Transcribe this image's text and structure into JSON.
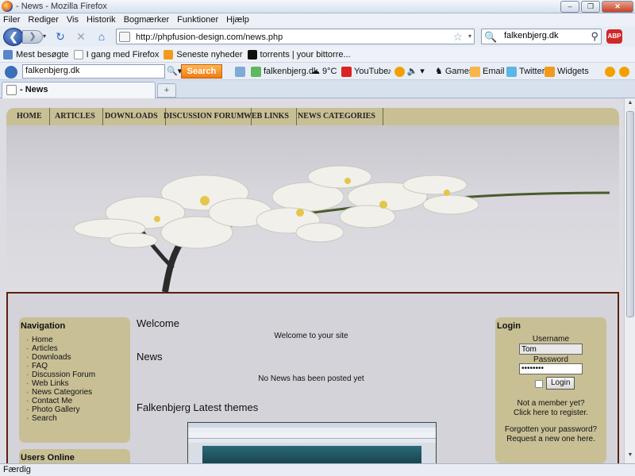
{
  "window": {
    "title": "- News - Mozilla Firefox"
  },
  "menu": [
    "Filer",
    "Rediger",
    "Vis",
    "Historik",
    "Bogmærker",
    "Funktioner",
    "Hjælp"
  ],
  "nav": {
    "url": "http://phpfusion-design.com/news.php",
    "search_value": "falkenbjerg.dk",
    "abp_label": "ABP"
  },
  "bookmarks": [
    {
      "label": "Mest besøgte",
      "icon": "most-visited-icon"
    },
    {
      "label": "I gang med Firefox",
      "icon": "page-icon"
    },
    {
      "label": "Seneste nyheder",
      "icon": "rss-icon"
    },
    {
      "label": "torrents | your bittorre...",
      "icon": "torrent-icon"
    }
  ],
  "toolbar2": {
    "search_value": "falkenbjerg.dk",
    "search_button": "Search",
    "domain": "falkenbjerg.dk",
    "weather": "9°C",
    "youtube": "YouTube",
    "games": "Games",
    "email": "Email",
    "twitter": "Twitter",
    "widgets": "Widgets"
  },
  "tab": {
    "title": "- News",
    "new_tab": "+"
  },
  "site": {
    "nav": [
      "HOME",
      "ARTICLES",
      "DOWNLOADS",
      "DISCUSSION FORUM",
      "WEB LINKS",
      "NEWS CATEGORIES"
    ],
    "navigation": {
      "title": "Navigation",
      "items": [
        "Home",
        "Articles",
        "Downloads",
        "FAQ",
        "Discussion Forum",
        "Web Links",
        "News Categories",
        "Contact Me",
        "Photo Gallery",
        "Search"
      ]
    },
    "users_online_title": "Users Online",
    "content": {
      "welcome_title": "Welcome",
      "welcome_text": "Welcome to your site",
      "news_title": "News",
      "news_text": "No News has been posted yet",
      "themes_title": "Falkenbjerg Latest themes"
    },
    "login": {
      "title": "Login",
      "username_label": "Username",
      "username_value": "Tom",
      "password_label": "Password",
      "password_value": "••••••••",
      "button": "Login",
      "register_q": "Not a member yet?",
      "register_link": "Click here to register.",
      "forgot_q": "Forgotten your password?",
      "forgot_link": "Request a new one here."
    }
  },
  "status": "Færdig",
  "colors": {
    "site_nav": "#c8bf95",
    "page_border": "#5e1f13",
    "accent_orange": "#f07a10"
  }
}
